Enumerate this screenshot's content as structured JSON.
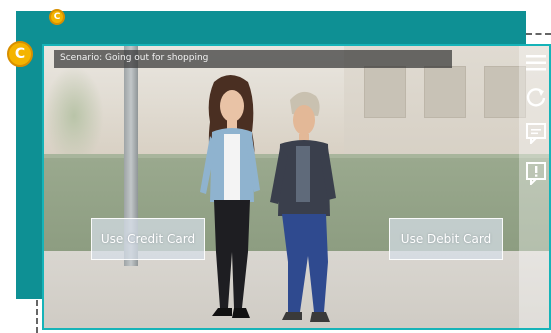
{
  "scenario": {
    "text": "Scenario: Going out for shopping"
  },
  "choices": {
    "credit": "Use Credit Card",
    "debit": "Use Debit Card"
  },
  "markers": {
    "small": "C",
    "large": "C"
  },
  "sidebar": {
    "icons": [
      "menu-icon",
      "restart-icon",
      "transcript-icon",
      "feedback-icon"
    ]
  },
  "colors": {
    "frame": "#0e9094",
    "accent": "#16b3b8",
    "marker": "#f4b400"
  }
}
